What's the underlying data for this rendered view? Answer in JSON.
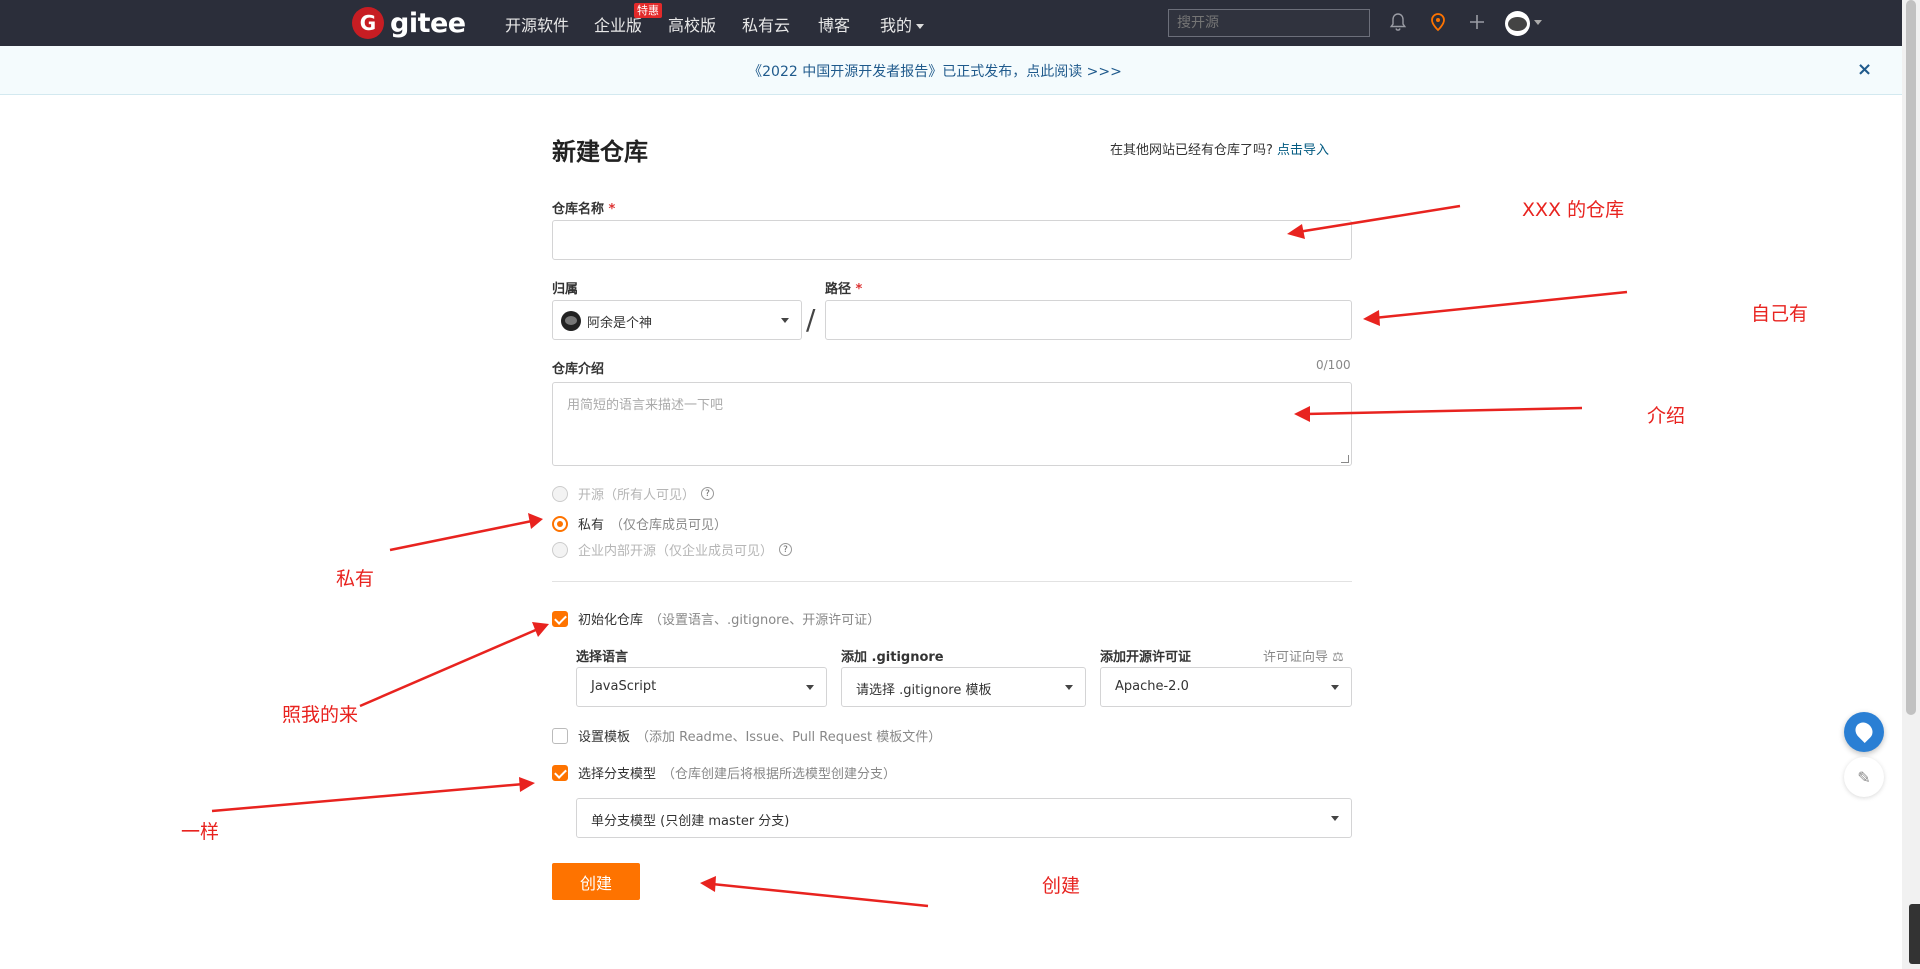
{
  "nav": {
    "logo_letter": "G",
    "logo_text": "gitee",
    "items": [
      "开源软件",
      "企业版",
      "高校版",
      "私有云",
      "博客",
      "我的"
    ],
    "tag": "特惠",
    "search_placeholder": "搜开源",
    "icons": [
      "bell-icon",
      "location-pin-icon",
      "plus-icon",
      "user-avatar"
    ]
  },
  "banner": {
    "text": "《2022 中国开源开发者报告》已正式发布，点此阅读 >>>",
    "close": "×"
  },
  "form": {
    "title": "新建仓库",
    "import_hint": "在其他网站已经有仓库了吗?",
    "import_link": "点击导入",
    "repo_name_label": "仓库名称",
    "required_mark": "*",
    "owner_label": "归属",
    "owner_value": "阿余是个神",
    "path_label": "路径",
    "slash": "/",
    "intro_label": "仓库介绍",
    "intro_counter": "0/100",
    "intro_placeholder": "用简短的语言来描述一下吧",
    "visibility": [
      {
        "label": "开源",
        "note": "（所有人可见）",
        "selected": false,
        "help": true
      },
      {
        "label": "私有",
        "note": "（仅仓库成员可见）",
        "selected": true,
        "help": false
      },
      {
        "label": "企业内部开源",
        "note": "（仅企业成员可见）",
        "selected": false,
        "help": true
      }
    ],
    "init_repo": {
      "label": "初始化仓库",
      "note": "（设置语言、.gitignore、开源许可证）",
      "checked": true
    },
    "language_label": "选择语言",
    "language_value": "JavaScript",
    "gitignore_label": "添加 .gitignore",
    "gitignore_value": "请选择 .gitignore 模板",
    "license_label": "添加开源许可证",
    "license_guide": "许可证向导",
    "license_value": "Apache-2.0",
    "template": {
      "label": "设置模板",
      "note": "（添加 Readme、Issue、Pull Request 模板文件）",
      "checked": false
    },
    "branch_model": {
      "label": "选择分支模型",
      "note": "（仓库创建后将根据所选模型创建分支）",
      "checked": true
    },
    "branch_model_value": "单分支模型 (只创建 master 分支)",
    "create_button": "创建"
  },
  "annotations": {
    "repo_name": "XXX 的仓库",
    "path": "自己有",
    "intro": "介绍",
    "private": "私有",
    "follow": "照我的来",
    "same": "一样",
    "create": "创建"
  },
  "colors": {
    "nav_bg": "#2b2e3a",
    "accent": "#fe7300",
    "annotation": "#e8231f",
    "banner_text": "#1f5a8c"
  }
}
